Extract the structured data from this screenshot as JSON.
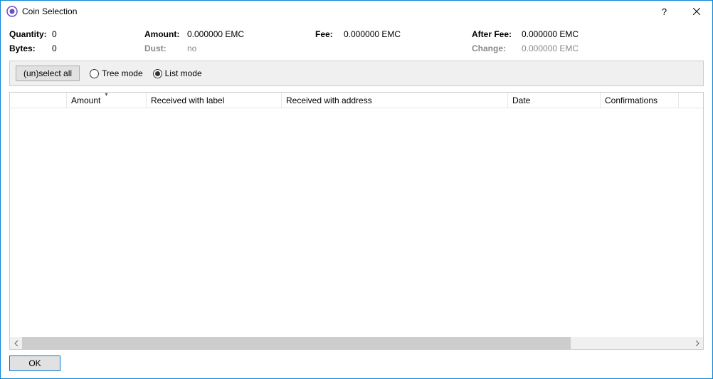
{
  "window": {
    "title": "Coin Selection"
  },
  "summary": {
    "row1": {
      "quantity_label": "Quantity:",
      "quantity_value": "0",
      "amount_label": "Amount:",
      "amount_value": "0.000000 EMC",
      "fee_label": "Fee:",
      "fee_value": "0.000000 EMC",
      "after_fee_label": "After Fee:",
      "after_fee_value": "0.000000 EMC"
    },
    "row2": {
      "bytes_label": "Bytes:",
      "bytes_value": "0",
      "dust_label": "Dust:",
      "dust_value": "no",
      "change_label": "Change:",
      "change_value": "0.000000 EMC"
    }
  },
  "toolbar": {
    "unselect_all_label": "(un)select all",
    "tree_mode_label": "Tree mode",
    "list_mode_label": "List mode",
    "selected_mode": "list"
  },
  "table": {
    "headers": {
      "amount": "Amount",
      "received_label": "Received with label",
      "received_address": "Received with address",
      "date": "Date",
      "confirmations": "Confirmations"
    },
    "rows": []
  },
  "footer": {
    "ok_label": "OK"
  }
}
